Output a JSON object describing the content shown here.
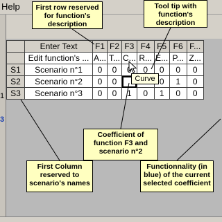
{
  "menu": {
    "help": "Help"
  },
  "left_edge": {
    "mark1": "1",
    "mark2": "3"
  },
  "grid": {
    "columns": [
      "Enter Text",
      "F1",
      "F2",
      "F3",
      "F4",
      "F5",
      "F6",
      "F..."
    ],
    "description_row": [
      "Edit function's ...",
      "A...",
      "T...",
      "C...",
      "R...",
      "E...",
      "P...",
      "Z..."
    ],
    "rows": [
      {
        "label": "S1",
        "name": "Scenario n°1",
        "values": [
          "0",
          "0",
          "0",
          "0",
          "0",
          "0",
          "0"
        ]
      },
      {
        "label": "S2",
        "name": "Scenario n°2",
        "values": [
          "0",
          "0",
          "",
          "",
          "0",
          "1",
          "0"
        ]
      },
      {
        "label": "S3",
        "name": "Scenario n°3",
        "values": [
          "0",
          "0",
          "1",
          "0",
          "1",
          "0",
          "0"
        ]
      }
    ]
  },
  "tooltip": "Curve",
  "annotations": {
    "first_row": "First row reserved for function's description",
    "tool_tip": "Tool tip with function's description",
    "coefficient": "Coefficient of function F3 and scenario n°2",
    "first_column": "First Column reserved to scenario's names",
    "functionality": "Functionnality (in blue) of the current selected coefficient"
  }
}
